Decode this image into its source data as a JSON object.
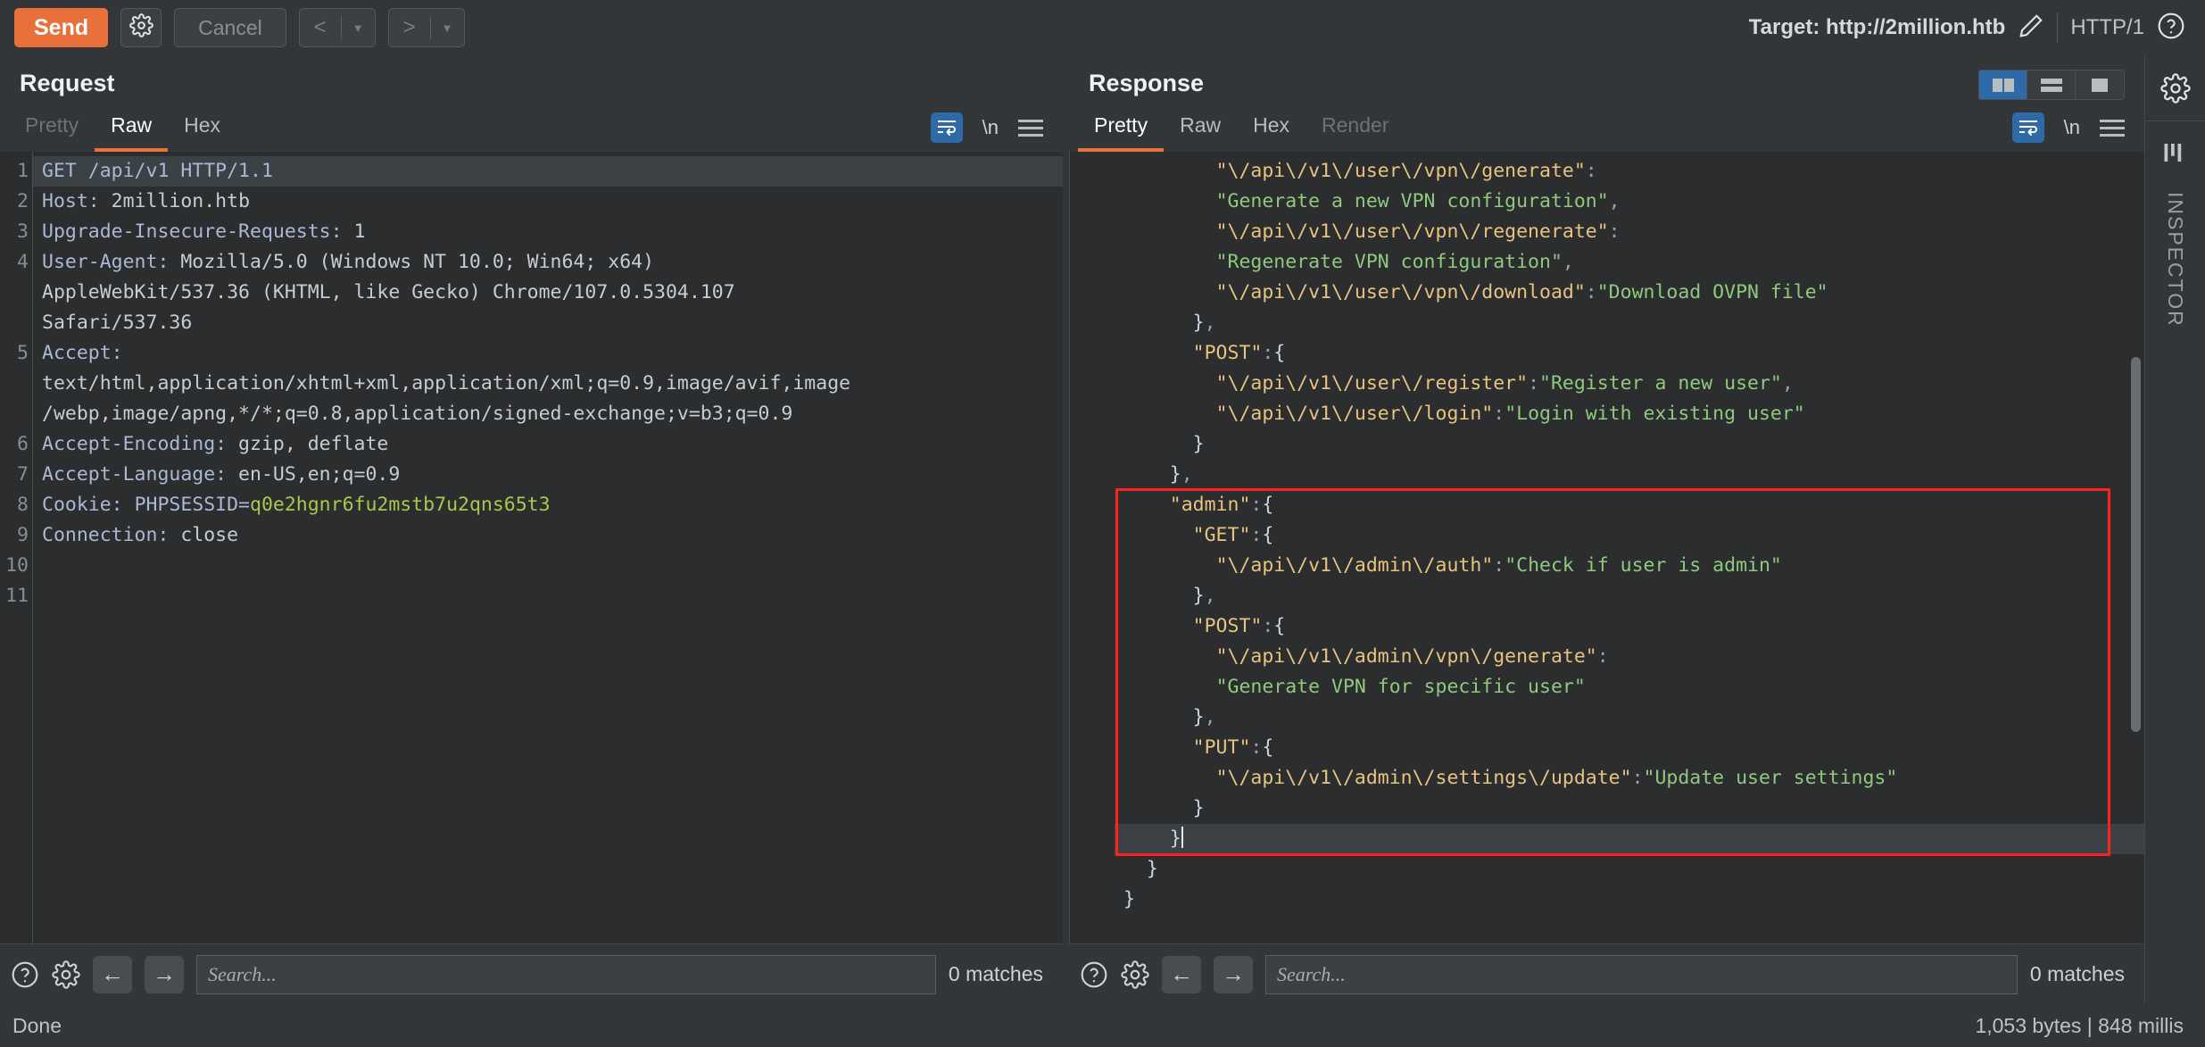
{
  "toolbar": {
    "send_label": "Send",
    "settings_icon": "gear-icon",
    "cancel_label": "Cancel",
    "prev_icon": "chevron-left-icon",
    "next_icon": "chevron-right-icon",
    "caret_icon": "caret-down-icon",
    "target_label": "Target: http://2million.htb",
    "edit_icon": "pencil-icon",
    "http_version": "HTTP/1",
    "help_icon": "question-circle-icon"
  },
  "request": {
    "title": "Request",
    "tabs": [
      {
        "label": "Pretty",
        "active": false,
        "disabled": true
      },
      {
        "label": "Raw",
        "active": true,
        "disabled": false
      },
      {
        "label": "Hex",
        "active": false,
        "disabled": false
      }
    ],
    "wrap_icon": "word-wrap-icon",
    "newline_label": "\\n",
    "menu_icon": "hamburger-menu-icon",
    "line_numbers": [
      "1",
      "2",
      "3",
      "4",
      "",
      "",
      "5",
      "",
      "",
      "6",
      "7",
      "8",
      "9",
      "10",
      "11"
    ],
    "lines": [
      {
        "n": "1",
        "highlight": true,
        "segments": [
          {
            "t": "GET /api/v1 HTTP/1.1",
            "c": "k-hdr"
          }
        ]
      },
      {
        "n": "2",
        "highlight": false,
        "segments": [
          {
            "t": "Host:",
            "c": "k-hdr"
          },
          {
            "t": " 2million.htb",
            "c": "k-val"
          }
        ]
      },
      {
        "n": "3",
        "highlight": false,
        "segments": [
          {
            "t": "Upgrade-Insecure-Requests:",
            "c": "k-hdr"
          },
          {
            "t": " 1",
            "c": "k-val"
          }
        ]
      },
      {
        "n": "4",
        "highlight": false,
        "segments": [
          {
            "t": "User-Agent:",
            "c": "k-hdr"
          },
          {
            "t": " Mozilla/5.0 (Windows NT 10.0; Win64; x64)",
            "c": "k-val"
          }
        ]
      },
      {
        "n": "",
        "highlight": false,
        "segments": [
          {
            "t": "AppleWebKit/537.36 (KHTML, like Gecko) Chrome/107.0.5304.107",
            "c": "k-val"
          }
        ]
      },
      {
        "n": "",
        "highlight": false,
        "segments": [
          {
            "t": "Safari/537.36",
            "c": "k-val"
          }
        ]
      },
      {
        "n": "5",
        "highlight": false,
        "segments": [
          {
            "t": "Accept:",
            "c": "k-hdr"
          }
        ]
      },
      {
        "n": "",
        "highlight": false,
        "segments": [
          {
            "t": "text/html,application/xhtml+xml,application/xml;q=0.9,image/avif,image",
            "c": "k-val"
          }
        ]
      },
      {
        "n": "",
        "highlight": false,
        "segments": [
          {
            "t": "/webp,image/apng,*/*;q=0.8,application/signed-exchange;v=b3;q=0.9",
            "c": "k-val"
          }
        ]
      },
      {
        "n": "6",
        "highlight": false,
        "segments": [
          {
            "t": "Accept-Encoding:",
            "c": "k-hdr"
          },
          {
            "t": " gzip, deflate",
            "c": "k-val"
          }
        ]
      },
      {
        "n": "7",
        "highlight": false,
        "segments": [
          {
            "t": "Accept-Language:",
            "c": "k-hdr"
          },
          {
            "t": " en-US,en;q=0.9",
            "c": "k-val"
          }
        ]
      },
      {
        "n": "8",
        "highlight": false,
        "segments": [
          {
            "t": "Cookie:",
            "c": "k-hdr"
          },
          {
            "t": " ",
            "c": "k-val"
          },
          {
            "t": "PHPSESSID=",
            "c": "k-hdr"
          },
          {
            "t": "q0e2hgnr6fu2mstb7u2qns65t3",
            "c": "k-green"
          }
        ]
      },
      {
        "n": "9",
        "highlight": false,
        "segments": [
          {
            "t": "Connection:",
            "c": "k-hdr"
          },
          {
            "t": " close",
            "c": "k-val"
          }
        ]
      },
      {
        "n": "10",
        "highlight": false,
        "segments": []
      },
      {
        "n": "11",
        "highlight": false,
        "segments": []
      }
    ],
    "search": {
      "help_icon": "question-circle-icon",
      "settings_icon": "gear-icon",
      "prev_icon": "arrow-left-icon",
      "next_icon": "arrow-right-icon",
      "placeholder": "Search...",
      "value": "",
      "matches": "0 matches"
    }
  },
  "response": {
    "title": "Response",
    "tabs": [
      {
        "label": "Pretty",
        "active": true,
        "disabled": false
      },
      {
        "label": "Raw",
        "active": false,
        "disabled": false
      },
      {
        "label": "Hex",
        "active": false,
        "disabled": false
      },
      {
        "label": "Render",
        "active": false,
        "disabled": true
      }
    ],
    "wrap_icon": "word-wrap-icon",
    "newline_label": "\\n",
    "menu_icon": "hamburger-menu-icon",
    "layout_buttons": [
      {
        "name": "side-by-side-layout",
        "active": true
      },
      {
        "name": "stacked-layout",
        "active": false
      },
      {
        "name": "single-pane-layout",
        "active": false
      }
    ],
    "lines": [
      {
        "indent": 4,
        "highlight": false,
        "segments": [
          {
            "t": "\"\\/api\\/v1\\/user\\/vpn\\/generate\"",
            "c": "k-key"
          },
          {
            "t": ":",
            "c": "k-punct"
          }
        ]
      },
      {
        "indent": 4,
        "highlight": false,
        "segments": [
          {
            "t": "\"Generate a new VPN configuration\"",
            "c": "k-str"
          },
          {
            "t": ",",
            "c": "k-punct"
          }
        ]
      },
      {
        "indent": 4,
        "highlight": false,
        "segments": [
          {
            "t": "\"\\/api\\/v1\\/user\\/vpn\\/regenerate\"",
            "c": "k-key"
          },
          {
            "t": ":",
            "c": "k-punct"
          }
        ]
      },
      {
        "indent": 4,
        "highlight": false,
        "segments": [
          {
            "t": "\"Regenerate VPN configuration\"",
            "c": "k-str"
          },
          {
            "t": ",",
            "c": "k-punct"
          }
        ]
      },
      {
        "indent": 4,
        "highlight": false,
        "segments": [
          {
            "t": "\"\\/api\\/v1\\/user\\/vpn\\/download\"",
            "c": "k-key"
          },
          {
            "t": ":",
            "c": "k-punct"
          },
          {
            "t": "\"Download OVPN file\"",
            "c": "k-str"
          }
        ]
      },
      {
        "indent": 3,
        "highlight": false,
        "segments": [
          {
            "t": "}",
            "c": "k-brc"
          },
          {
            "t": ",",
            "c": "k-punct"
          }
        ]
      },
      {
        "indent": 3,
        "highlight": false,
        "segments": [
          {
            "t": "\"POST\"",
            "c": "k-key"
          },
          {
            "t": ":",
            "c": "k-punct"
          },
          {
            "t": "{",
            "c": "k-brc"
          }
        ]
      },
      {
        "indent": 4,
        "highlight": false,
        "segments": [
          {
            "t": "\"\\/api\\/v1\\/user\\/register\"",
            "c": "k-key"
          },
          {
            "t": ":",
            "c": "k-punct"
          },
          {
            "t": "\"Register a new user\"",
            "c": "k-str"
          },
          {
            "t": ",",
            "c": "k-punct"
          }
        ]
      },
      {
        "indent": 4,
        "highlight": false,
        "segments": [
          {
            "t": "\"\\/api\\/v1\\/user\\/login\"",
            "c": "k-key"
          },
          {
            "t": ":",
            "c": "k-punct"
          },
          {
            "t": "\"Login with existing user\"",
            "c": "k-str"
          }
        ]
      },
      {
        "indent": 3,
        "highlight": false,
        "segments": [
          {
            "t": "}",
            "c": "k-brc"
          }
        ]
      },
      {
        "indent": 2,
        "highlight": false,
        "segments": [
          {
            "t": "}",
            "c": "k-brc"
          },
          {
            "t": ",",
            "c": "k-punct"
          }
        ]
      },
      {
        "indent": 2,
        "highlight": false,
        "segments": [
          {
            "t": "\"admin\"",
            "c": "k-key"
          },
          {
            "t": ":",
            "c": "k-punct"
          },
          {
            "t": "{",
            "c": "k-brc"
          }
        ]
      },
      {
        "indent": 3,
        "highlight": false,
        "segments": [
          {
            "t": "\"GET\"",
            "c": "k-key"
          },
          {
            "t": ":",
            "c": "k-punct"
          },
          {
            "t": "{",
            "c": "k-brc"
          }
        ]
      },
      {
        "indent": 4,
        "highlight": false,
        "segments": [
          {
            "t": "\"\\/api\\/v1\\/admin\\/auth\"",
            "c": "k-key"
          },
          {
            "t": ":",
            "c": "k-punct"
          },
          {
            "t": "\"Check if user is admin\"",
            "c": "k-str"
          }
        ]
      },
      {
        "indent": 3,
        "highlight": false,
        "segments": [
          {
            "t": "}",
            "c": "k-brc"
          },
          {
            "t": ",",
            "c": "k-punct"
          }
        ]
      },
      {
        "indent": 3,
        "highlight": false,
        "segments": [
          {
            "t": "\"POST\"",
            "c": "k-key"
          },
          {
            "t": ":",
            "c": "k-punct"
          },
          {
            "t": "{",
            "c": "k-brc"
          }
        ]
      },
      {
        "indent": 4,
        "highlight": false,
        "segments": [
          {
            "t": "\"\\/api\\/v1\\/admin\\/vpn\\/generate\"",
            "c": "k-key"
          },
          {
            "t": ":",
            "c": "k-punct"
          }
        ]
      },
      {
        "indent": 4,
        "highlight": false,
        "segments": [
          {
            "t": "\"Generate VPN for specific user\"",
            "c": "k-str"
          }
        ]
      },
      {
        "indent": 3,
        "highlight": false,
        "segments": [
          {
            "t": "}",
            "c": "k-brc"
          },
          {
            "t": ",",
            "c": "k-punct"
          }
        ]
      },
      {
        "indent": 3,
        "highlight": false,
        "segments": [
          {
            "t": "\"PUT\"",
            "c": "k-key"
          },
          {
            "t": ":",
            "c": "k-punct"
          },
          {
            "t": "{",
            "c": "k-brc"
          }
        ]
      },
      {
        "indent": 4,
        "highlight": false,
        "segments": [
          {
            "t": "\"\\/api\\/v1\\/admin\\/settings\\/update\"",
            "c": "k-key"
          },
          {
            "t": ":",
            "c": "k-punct"
          },
          {
            "t": "\"Update user settings\"",
            "c": "k-str"
          }
        ]
      },
      {
        "indent": 3,
        "highlight": false,
        "segments": [
          {
            "t": "}",
            "c": "k-brc"
          }
        ]
      },
      {
        "indent": 2,
        "highlight": true,
        "caret": true,
        "segments": [
          {
            "t": "}",
            "c": "k-brc"
          }
        ]
      },
      {
        "indent": 1,
        "highlight": false,
        "segments": [
          {
            "t": "}",
            "c": "k-brc"
          }
        ]
      },
      {
        "indent": 0,
        "highlight": false,
        "segments": [
          {
            "t": "}",
            "c": "k-brc"
          }
        ]
      }
    ],
    "search": {
      "help_icon": "question-circle-icon",
      "settings_icon": "gear-icon",
      "prev_icon": "arrow-left-icon",
      "next_icon": "arrow-right-icon",
      "placeholder": "Search...",
      "value": "",
      "matches": "0 matches"
    }
  },
  "rail": {
    "settings_icon": "gear-icon",
    "inspector_icon": "sliders-icon",
    "inspector_label": "INSPECTOR"
  },
  "statusbar": {
    "left": "Done",
    "right": "1,053 bytes | 848 millis"
  },
  "colors": {
    "accent": "#e8703a",
    "selection_blue": "#2e6aa8",
    "highlight_red": "#ff2020",
    "json_key": "#e8c37e",
    "json_string": "#8fc97e",
    "cookie_value": "#a8c94a",
    "header_name": "#aab8d4",
    "background": "#333638",
    "editor_background": "#2b2d2f"
  }
}
